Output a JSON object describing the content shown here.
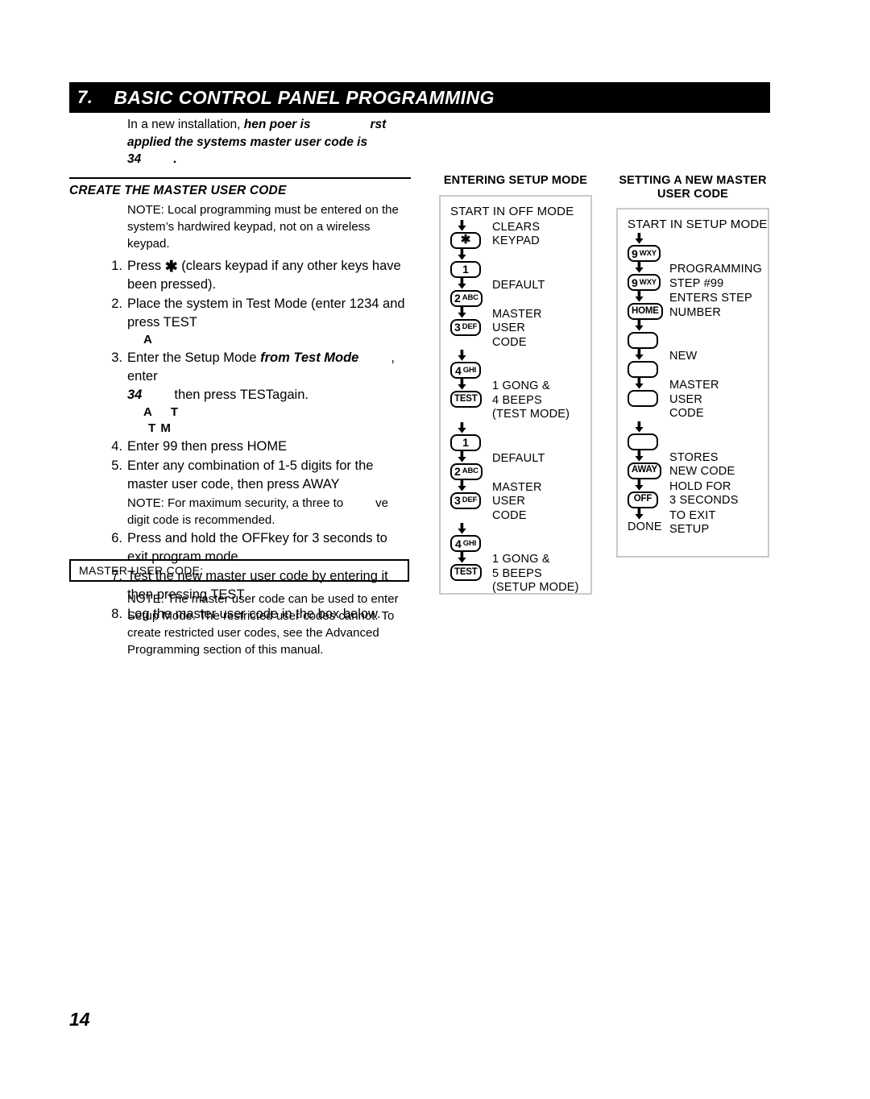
{
  "chapter": {
    "number": "7.",
    "title": "BASIC CONTROL PANEL PROGRAMMING"
  },
  "intro": {
    "lead": "In a new installation,",
    "italic_1": "hen poer is",
    "italic_2": "rst",
    "italic_3": "applied the systems master user code is",
    "italic_4": "34",
    "italic_5": "."
  },
  "section": {
    "heading": "CREATE THE MASTER USER CODE",
    "note": "NOTE: Local programming must be entered on the system’s hardwired keypad, not on a wireless keypad."
  },
  "steps": [
    {
      "num": "1.",
      "pre": "Press",
      "icon": "asterisk-key-icon",
      "post": "(clears keypad if any other keys have been pressed)."
    },
    {
      "num": "2.",
      "text": "Place the system in Test Mode (enter 1234 and press TEST",
      "fragment": "A"
    },
    {
      "num": "3.",
      "text_a": "Enter the Setup Mode",
      "italic_a": "from Test Mode",
      "text_b": ", enter",
      "italic_b": "34",
      "text_c": "then press TESTagain.",
      "fragment_a": "A",
      "fragment_b": "T",
      "fragment_c": "T M"
    },
    {
      "num": "4.",
      "text": "Enter 99 then press HOME"
    },
    {
      "num": "5.",
      "text": "Enter any combination of 1-5 digits for the master user code, then press AWAY",
      "note_a": "NOTE: For maximum security, a three to",
      "note_b": "ve digit code is recommended."
    },
    {
      "num": "6.",
      "text": "Press and hold the OFFkey for 3 seconds to exit program mode."
    },
    {
      "num": "7.",
      "text": "Test the new master user code by entering it then pressing TEST"
    },
    {
      "num": "8.",
      "text": "Log the master user code in the box below."
    }
  ],
  "code_box": {
    "label": "MASTER USER CODE:"
  },
  "bottom_note": "NOTE: The master user code can be used to enter Setup Mode. The restricted user codes cannot. To create restricted user codes, see the  Advanced Programming  section of this manual.",
  "flow_setup": {
    "heading": "ENTERING\nSETUP\nMODE",
    "start": "START IN OFF MODE",
    "rows": [
      {
        "key_digit": "✱",
        "key_letters": "",
        "key_word": "",
        "label": "CLEARS\nKEYPAD"
      },
      {
        "key_digit": "1",
        "key_letters": "",
        "key_word": "",
        "label": ""
      },
      {
        "key_digit": "2",
        "key_letters": "ABC",
        "key_word": "",
        "label": "DEFAULT"
      },
      {
        "key_digit": "3",
        "key_letters": "DEF",
        "key_word": "",
        "label": "MASTER\nUSER\nCODE"
      },
      {
        "key_digit": "4",
        "key_letters": "GHI",
        "key_word": "",
        "label": ""
      },
      {
        "key_digit": "",
        "key_letters": "",
        "key_word": "TEST",
        "label": "1 GONG &\n4 BEEPS\n(TEST MODE)"
      },
      {
        "key_digit": "1",
        "key_letters": "",
        "key_word": "",
        "label": ""
      },
      {
        "key_digit": "2",
        "key_letters": "ABC",
        "key_word": "",
        "label": "DEFAULT"
      },
      {
        "key_digit": "3",
        "key_letters": "DEF",
        "key_word": "",
        "label": "MASTER\nUSER\nCODE"
      },
      {
        "key_digit": "4",
        "key_letters": "GHI",
        "key_word": "",
        "label": ""
      },
      {
        "key_digit": "",
        "key_letters": "",
        "key_word": "TEST",
        "label": "1 GONG &\n5 BEEPS\n(SETUP MODE)"
      }
    ]
  },
  "flow_newcode": {
    "heading": "SETTING A\nNEW MASTER\nUSER CODE",
    "start": "START IN SETUP MODE",
    "rows": [
      {
        "key_digit": "9",
        "key_letters": "WXY",
        "key_word": "",
        "label": ""
      },
      {
        "key_digit": "9",
        "key_letters": "WXY",
        "key_word": "",
        "label": "PROGRAMMING\nSTEP #99"
      },
      {
        "key_digit": "",
        "key_letters": "",
        "key_word": "HOME",
        "label": "ENTERS STEP\nNUMBER"
      },
      {
        "key_digit": "",
        "key_letters": "",
        "key_word": "",
        "label": ""
      },
      {
        "key_digit": "",
        "key_letters": "",
        "key_word": "",
        "label": "NEW"
      },
      {
        "key_digit": "",
        "key_letters": "",
        "key_word": "",
        "label": "MASTER\nUSER\nCODE"
      },
      {
        "key_digit": "",
        "key_letters": "",
        "key_word": "",
        "label": ""
      },
      {
        "key_digit": "",
        "key_letters": "",
        "key_word": "AWAY",
        "label": "STORES\nNEW CODE"
      },
      {
        "key_digit": "",
        "key_letters": "",
        "key_word": "OFF",
        "label": "HOLD FOR\n3 SECONDS"
      }
    ],
    "done_word": "DONE",
    "done_label": "TO EXIT\nSETUP"
  },
  "page_number": "14"
}
